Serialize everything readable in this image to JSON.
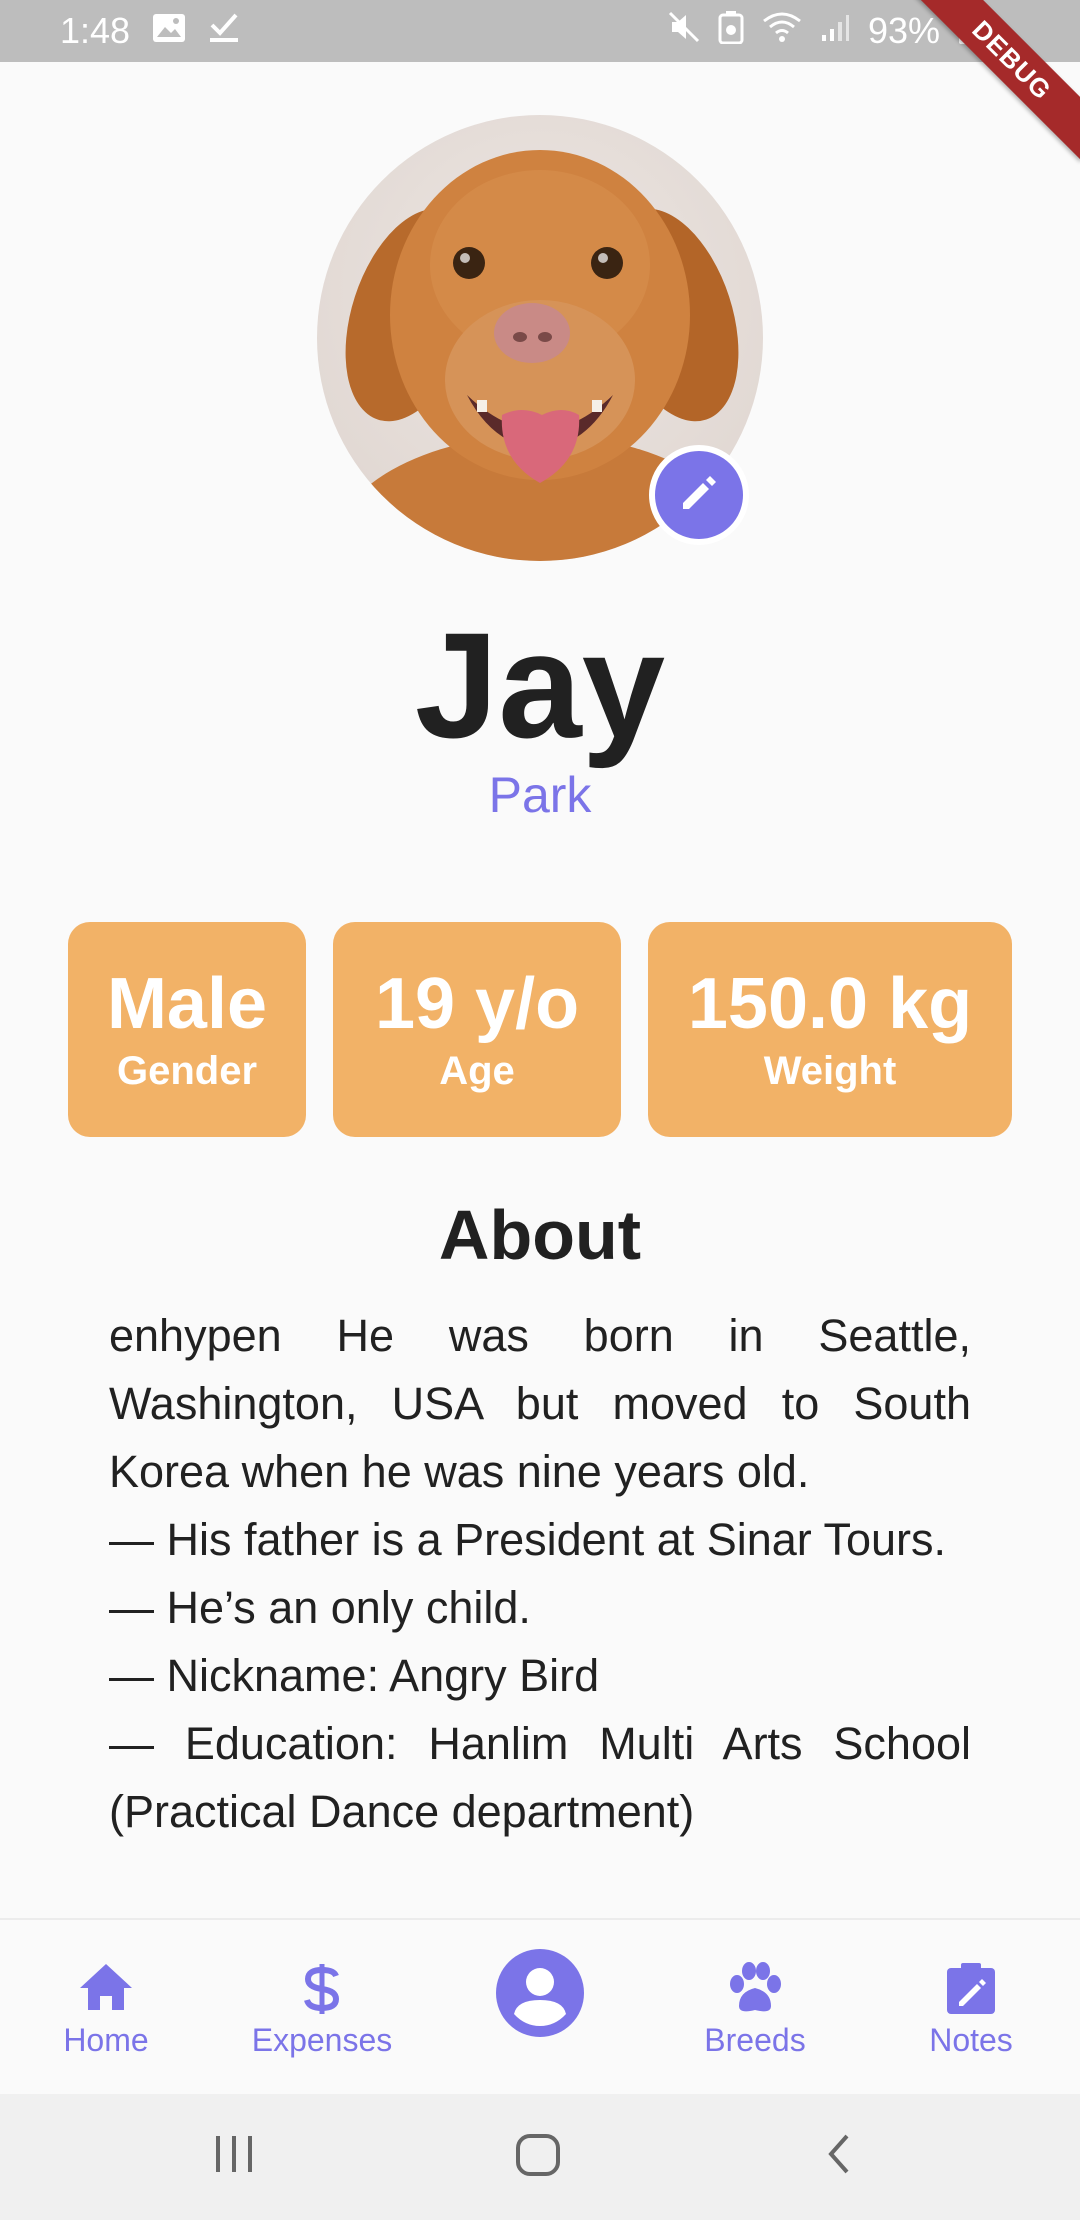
{
  "status_bar": {
    "time": "1:48",
    "battery": "93%",
    "icons": [
      "image-icon",
      "checkmark-icon",
      "mute-icon",
      "battery-saver-icon",
      "wifi-icon",
      "signal-icon",
      "battery-icon"
    ]
  },
  "debug_banner": "DEBUG",
  "profile": {
    "first_name": "Jay",
    "last_name": "Park"
  },
  "stats": [
    {
      "value": "Male",
      "label": "Gender"
    },
    {
      "value": "19 y/o",
      "label": "Age"
    },
    {
      "value": "150.0 kg",
      "label": "Weight"
    }
  ],
  "about": {
    "title": "About",
    "paragraphs": [
      "enhypen He was born in Seattle, Washington, USA but moved to South Korea when he was nine years old.",
      "— His father is a President at Sinar Tours.",
      "— He’s an only child.",
      "— Nickname: Angry Bird",
      "— Education: Hanlim Multi Arts School (Practical Dance department)"
    ]
  },
  "bottom_nav": {
    "items": [
      {
        "label": "Home",
        "icon": "home-icon"
      },
      {
        "label": "Expenses",
        "icon": "dollar-icon"
      },
      {
        "label": "",
        "icon": "account-icon"
      },
      {
        "label": "Breeds",
        "icon": "paw-icon"
      },
      {
        "label": "Notes",
        "icon": "note-edit-icon"
      }
    ]
  },
  "colors": {
    "accent": "#7b74e8",
    "card": "#f2b267",
    "text": "#212121"
  }
}
